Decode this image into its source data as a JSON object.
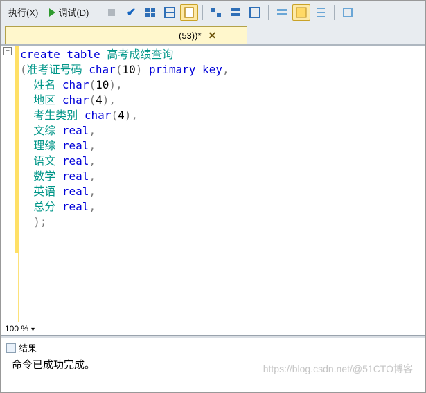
{
  "toolbar": {
    "execute_label": "执行(X)",
    "debug_label": "调试(D)"
  },
  "tab": {
    "title": "(53))*",
    "close": "✕"
  },
  "code": {
    "lines": [
      {
        "indent": 0,
        "parts": [
          {
            "t": "create table ",
            "c": "kw"
          },
          {
            "t": "高考成绩查询",
            "c": "ident"
          }
        ]
      },
      {
        "indent": 0,
        "parts": [
          {
            "t": "(",
            "c": "punct"
          },
          {
            "t": "准考证号码 ",
            "c": "ident"
          },
          {
            "t": "char",
            "c": "type"
          },
          {
            "t": "(",
            "c": "punct"
          },
          {
            "t": "10",
            "c": "num"
          },
          {
            "t": ")",
            "c": "punct"
          },
          {
            "t": " primary key",
            "c": "kw"
          },
          {
            "t": ",",
            "c": "punct"
          }
        ]
      },
      {
        "indent": 1,
        "parts": [
          {
            "t": "姓名 ",
            "c": "ident"
          },
          {
            "t": "char",
            "c": "type"
          },
          {
            "t": "(",
            "c": "punct"
          },
          {
            "t": "10",
            "c": "num"
          },
          {
            "t": ")",
            "c": "punct"
          },
          {
            "t": ",",
            "c": "punct"
          }
        ]
      },
      {
        "indent": 1,
        "parts": [
          {
            "t": "地区 ",
            "c": "ident"
          },
          {
            "t": "char",
            "c": "type"
          },
          {
            "t": "(",
            "c": "punct"
          },
          {
            "t": "4",
            "c": "num"
          },
          {
            "t": ")",
            "c": "punct"
          },
          {
            "t": ",",
            "c": "punct"
          }
        ]
      },
      {
        "indent": 1,
        "parts": [
          {
            "t": "考生类别 ",
            "c": "ident"
          },
          {
            "t": "char",
            "c": "type"
          },
          {
            "t": "(",
            "c": "punct"
          },
          {
            "t": "4",
            "c": "num"
          },
          {
            "t": ")",
            "c": "punct"
          },
          {
            "t": ",",
            "c": "punct"
          }
        ]
      },
      {
        "indent": 1,
        "parts": [
          {
            "t": "文综 ",
            "c": "ident"
          },
          {
            "t": "real",
            "c": "type"
          },
          {
            "t": ",",
            "c": "punct"
          }
        ]
      },
      {
        "indent": 1,
        "parts": [
          {
            "t": "理综 ",
            "c": "ident"
          },
          {
            "t": "real",
            "c": "type"
          },
          {
            "t": ",",
            "c": "punct"
          }
        ]
      },
      {
        "indent": 1,
        "parts": [
          {
            "t": "语文 ",
            "c": "ident"
          },
          {
            "t": "real",
            "c": "type"
          },
          {
            "t": ",",
            "c": "punct"
          }
        ]
      },
      {
        "indent": 1,
        "parts": [
          {
            "t": "数学 ",
            "c": "ident"
          },
          {
            "t": "real",
            "c": "type"
          },
          {
            "t": ",",
            "c": "punct"
          }
        ]
      },
      {
        "indent": 1,
        "parts": [
          {
            "t": "英语 ",
            "c": "ident"
          },
          {
            "t": "real",
            "c": "type"
          },
          {
            "t": ",",
            "c": "punct"
          }
        ]
      },
      {
        "indent": 1,
        "parts": [
          {
            "t": "总分 ",
            "c": "ident"
          },
          {
            "t": "real",
            "c": "type"
          },
          {
            "t": ",",
            "c": "punct"
          }
        ]
      },
      {
        "indent": 1,
        "parts": [
          {
            "t": ")",
            "c": "punct"
          },
          {
            "t": ";",
            "c": "punct"
          }
        ]
      }
    ]
  },
  "zoom": {
    "value": "100 %"
  },
  "results": {
    "tab_label": "结果",
    "message": "命令已成功完成。"
  },
  "watermark": "https://blog.csdn.net/@51CTO博客"
}
